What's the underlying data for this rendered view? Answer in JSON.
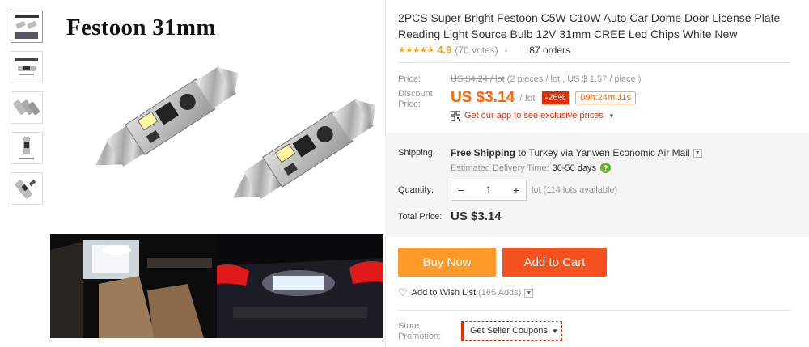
{
  "gallery": {
    "caption": "Festoon 31mm",
    "thumb_count": 5
  },
  "product": {
    "title": "2PCS Super Bright Festoon C5W C10W Auto Car Dome Door License Plate Reading Light Source Bulb 12V 31mm CREE Led Chips White New",
    "stars": "★★★★★",
    "rating": "4.9",
    "votes": "(70 votes)",
    "orders": "87 orders"
  },
  "price": {
    "price_label": "Price:",
    "old_price": "US $4.24 / lot",
    "old_price_note": "(2 pieces / lot , US $ 1.57 / piece )",
    "discount_label_1": "Discount",
    "discount_label_2": "Price:",
    "current": "US $3.14",
    "per": "/ lot",
    "discount_badge": "-26%",
    "timer": "09h:24m:11s",
    "app_promo": "Get our app to see exclusive prices"
  },
  "shipping": {
    "label": "Shipping:",
    "free": "Free Shipping",
    "to_text": "to Turkey via Yanwen Economic Air Mail",
    "est_label": "Estimated Delivery Time:",
    "est_days": "30-50 days"
  },
  "quantity": {
    "label": "Quantity:",
    "value": "1",
    "minus": "−",
    "plus": "+",
    "available": "lot (114 lots available)"
  },
  "total": {
    "label": "Total Price:",
    "value": "US $3.14"
  },
  "actions": {
    "buy_now": "Buy Now",
    "add_to_cart": "Add to Cart",
    "wishlist": "Add to Wish List",
    "wishlist_adds": "(165 Adds)"
  },
  "store": {
    "label_1": "Store",
    "label_2": "Promotion:",
    "coupon": "Get Seller Coupons"
  },
  "colors": {
    "price_orange": "#ff6600",
    "buy_now": "#ff9a2a",
    "add_to_cart": "#f5511e",
    "discount_red": "#e62e04",
    "star": "#f5a623"
  }
}
